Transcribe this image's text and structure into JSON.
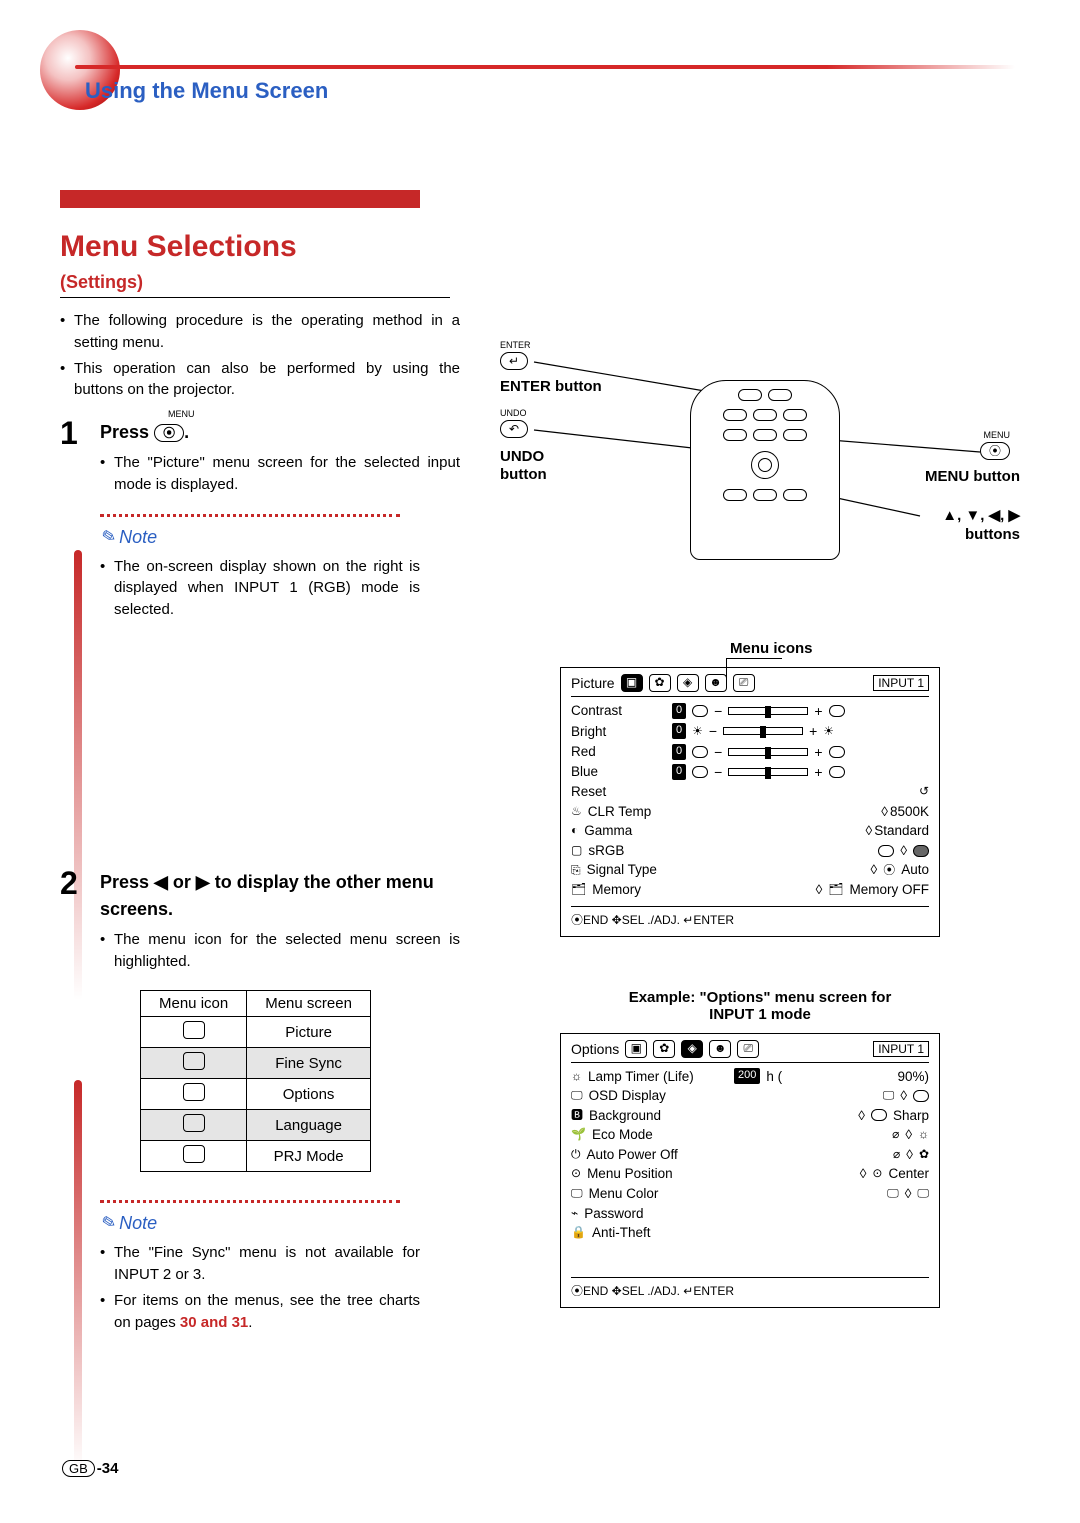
{
  "header": {
    "section_title": "Using the Menu Screen"
  },
  "page": {
    "title": "Menu Selections",
    "subtitle": "(Settings)"
  },
  "intro_bullets": [
    "The following procedure is the operating method in a setting menu.",
    "This operation can also be performed by using the buttons on the projector."
  ],
  "step1": {
    "num": "1",
    "label_tiny": "MENU",
    "head_prefix": "Press",
    "key_glyph": "⦿",
    "head_suffix": ".",
    "bullets": [
      "The \"Picture\" menu screen for the selected input mode is displayed."
    ]
  },
  "note1": {
    "heading": "Note",
    "bullets": [
      "The on-screen display shown on the right is displayed when INPUT 1 (RGB) mode is selected."
    ]
  },
  "step2": {
    "num": "2",
    "head": "Press ◀ or ▶ to display the other menu screens.",
    "bullets": [
      "The menu icon for the selected menu screen is highlighted."
    ]
  },
  "mi_table": {
    "headers": [
      "Menu icon",
      "Menu screen"
    ],
    "rows": [
      {
        "icon": "▣",
        "name": "Picture",
        "shade": false
      },
      {
        "icon": "✿",
        "name": "Fine Sync",
        "shade": true
      },
      {
        "icon": "◈",
        "name": "Options",
        "shade": false
      },
      {
        "icon": "☻",
        "name": "Language",
        "shade": true
      },
      {
        "icon": "⎚",
        "name": "PRJ Mode",
        "shade": false
      }
    ]
  },
  "note2": {
    "heading": "Note",
    "bullets": [
      "The \"Fine Sync\" menu is not available for INPUT 2 or 3.",
      "For items on the menus, see the tree charts on pages "
    ],
    "page_refs": "30 and 31",
    "tail": "."
  },
  "remote": {
    "enter_tiny": "ENTER",
    "enter_key": "↵",
    "enter_label": "ENTER button",
    "undo_tiny": "UNDO",
    "undo_key": "↶",
    "undo_label_1": "UNDO",
    "undo_label_2": "button",
    "menu_tiny": "MENU",
    "menu_key": "⦿",
    "menu_label": "MENU button",
    "arrows_line1": "▲, ▼, ◀, ▶",
    "arrows_line2": "buttons"
  },
  "menu_icons_label": "Menu icons",
  "osd1": {
    "tab": "Picture",
    "input": "INPUT 1",
    "rows": [
      {
        "name": "Contrast",
        "slider": true,
        "zero": "0"
      },
      {
        "name": "Bright",
        "slider": true,
        "zero": "0"
      },
      {
        "name": "Red",
        "slider": true,
        "zero": "0"
      },
      {
        "name": "Blue",
        "slider": true,
        "zero": "0"
      },
      {
        "name": "Reset"
      }
    ],
    "rows2": [
      {
        "ico": "♨",
        "name": "CLR Temp",
        "val": "8500K"
      },
      {
        "ico": "◐",
        "name": "Gamma",
        "val": "Standard"
      },
      {
        "ico": "▢",
        "name": "sRGB",
        "val": ""
      },
      {
        "ico": "⎘",
        "name": "Signal Type",
        "val": "Auto"
      },
      {
        "ico": "🗂",
        "name": "Memory",
        "val": "Memory OFF"
      }
    ],
    "footer": "⦿END ✥SEL ./ADJ. ↵ENTER"
  },
  "example_label_1": "Example: \"Options\" menu screen for",
  "example_label_2": "INPUT 1 mode",
  "osd2": {
    "tab": "Options",
    "input": "INPUT 1",
    "lamp": {
      "name": "Lamp Timer  (Life)",
      "hours": "200",
      "h": "h (",
      "pct": "90%)"
    },
    "rows": [
      {
        "ico": "🖵",
        "name": "OSD Display",
        "val": ""
      },
      {
        "ico": "🅱",
        "name": "Background",
        "val": "Sharp"
      },
      {
        "ico": "🌱",
        "name": "Eco Mode",
        "val": ""
      },
      {
        "ico": "⏻",
        "name": "Auto Power Off",
        "val": ""
      },
      {
        "ico": "⊙",
        "name": "Menu Position",
        "val": "Center"
      },
      {
        "ico": "🖵",
        "name": "Menu Color",
        "val": ""
      },
      {
        "ico": "⌁",
        "name": "Password",
        "val": ""
      },
      {
        "ico": "🔒",
        "name": "Anti-Theft",
        "val": ""
      }
    ],
    "footer": "⦿END ✥SEL ./ADJ. ↵ENTER"
  },
  "footer": {
    "gb": "GB",
    "page": "-34"
  }
}
